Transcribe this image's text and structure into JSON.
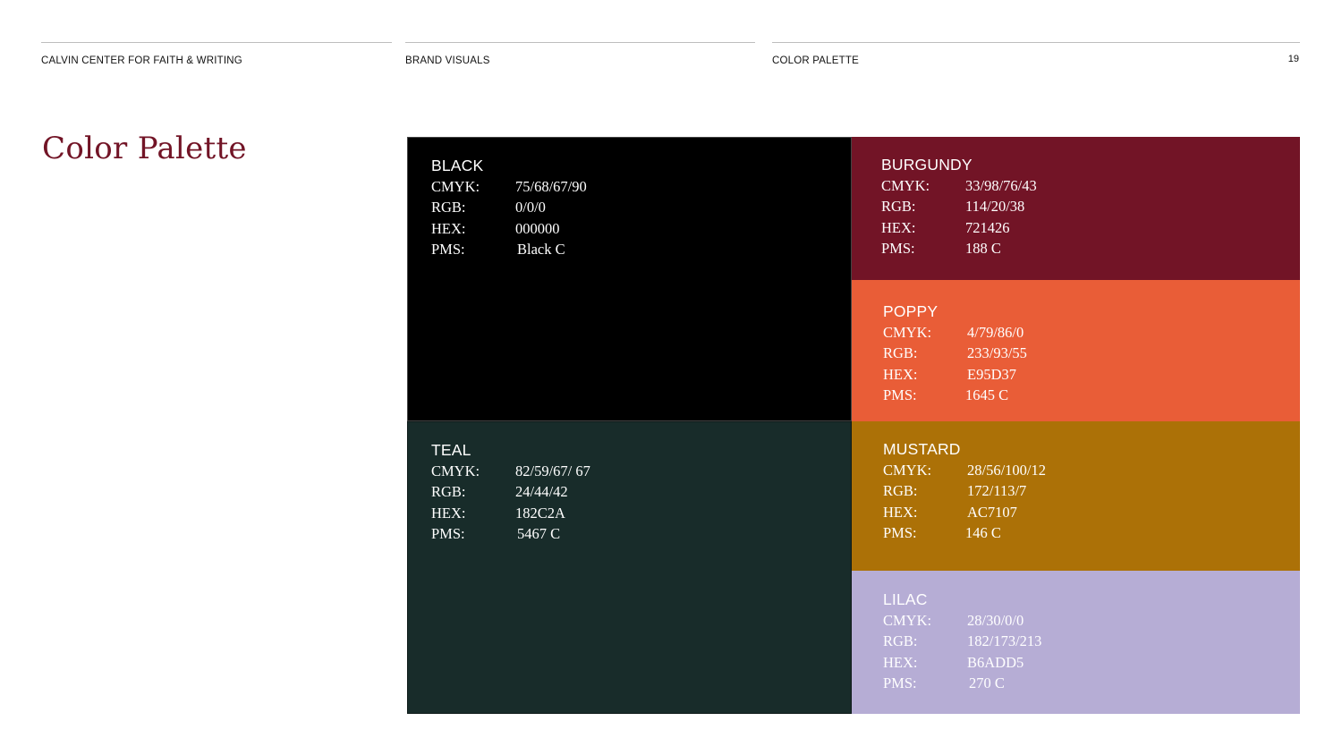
{
  "header": {
    "section1": "CALVIN CENTER FOR FAITH & WRITING",
    "section2": "BRAND VISUALS",
    "section3": "COLOR PALETTE",
    "page_number": "19"
  },
  "title": "Color Palette",
  "swatches": [
    {
      "name": "BLACK",
      "hex_color": "#000000",
      "text_color": "#ffffff",
      "labels": [
        "CMYK:",
        "RGB:",
        "HEX:",
        "PMS:"
      ],
      "values": [
        "75/68/67/90",
        "0/0/0",
        "000000",
        "Black C"
      ]
    },
    {
      "name": "BURGUNDY",
      "hex_color": "#721426",
      "text_color": "#ffffff",
      "labels": [
        "CMYK:",
        "RGB:",
        "HEX:",
        "PMS:"
      ],
      "values": [
        "33/98/76/43",
        "114/20/38",
        "721426",
        "188 C"
      ]
    },
    {
      "name": "POPPY",
      "hex_color": "#E95D37",
      "text_color": "#ffffff",
      "labels": [
        "CMYK:",
        "RGB:",
        "HEX:",
        "PMS:"
      ],
      "values": [
        "4/79/86/0",
        "233/93/55",
        "E95D37",
        "1645 C"
      ]
    },
    {
      "name": "TEAL",
      "hex_color": "#182C2A",
      "text_color": "#ffffff",
      "labels": [
        "CMYK:",
        "RGB:",
        "HEX:",
        "PMS:"
      ],
      "values": [
        "82/59/67/ 67",
        "24/44/42",
        "182C2A",
        "5467 C"
      ]
    },
    {
      "name": "MUSTARD",
      "hex_color": "#AC7107",
      "text_color": "#ffffff",
      "labels": [
        "CMYK:",
        "RGB:",
        "HEX:",
        "PMS:"
      ],
      "values": [
        "28/56/100/12",
        "172/113/7",
        "AC7107",
        "146 C"
      ]
    },
    {
      "name": "LILAC",
      "hex_color": "#B6ADD5",
      "text_color": "#ffffff",
      "labels": [
        "CMYK:",
        "RGB:",
        "HEX:",
        "PMS:"
      ],
      "values": [
        "28/30/0/0",
        "182/173/213",
        "B6ADD5",
        "270 C"
      ]
    }
  ]
}
